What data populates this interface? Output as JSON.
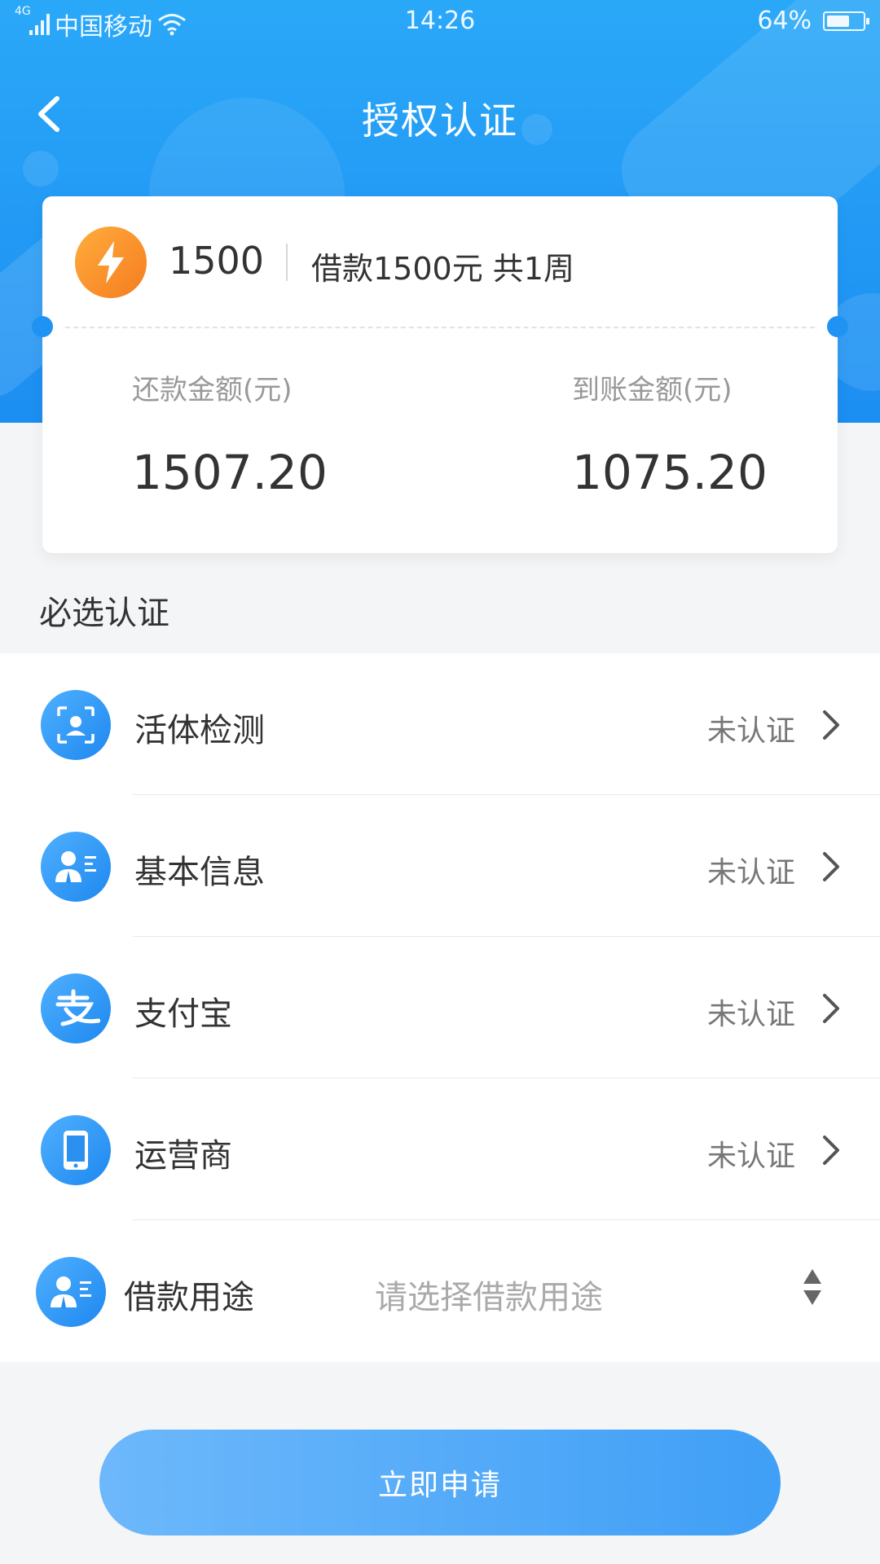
{
  "status_bar": {
    "network": "4G",
    "carrier": "中国移动",
    "time": "14:26",
    "battery": "64%",
    "battery_level": 0.64
  },
  "nav": {
    "title": "授权认证"
  },
  "loan_card": {
    "amount": "1500",
    "description": "借款1500元 共1周",
    "repay_label": "还款金额(元)",
    "repay_value": "1507.20",
    "arrive_label": "到账金额(元)",
    "arrive_value": "1075.20"
  },
  "section": {
    "title": "必选认证"
  },
  "verify_items": [
    {
      "label": "活体检测",
      "status": "未认证",
      "icon": "face-scan-icon"
    },
    {
      "label": "基本信息",
      "status": "未认证",
      "icon": "user-info-icon"
    },
    {
      "label": "支付宝",
      "status": "未认证",
      "icon": "alipay-icon"
    },
    {
      "label": "运营商",
      "status": "未认证",
      "icon": "phone-icon"
    }
  ],
  "purpose": {
    "label": "借款用途",
    "placeholder": "请选择借款用途",
    "icon": "user-info-icon"
  },
  "apply_button": {
    "label": "立即申请"
  },
  "colors": {
    "primary": "#1c8ef2",
    "accent_orange": "#f57c1f",
    "button": "#4fa8f8"
  }
}
